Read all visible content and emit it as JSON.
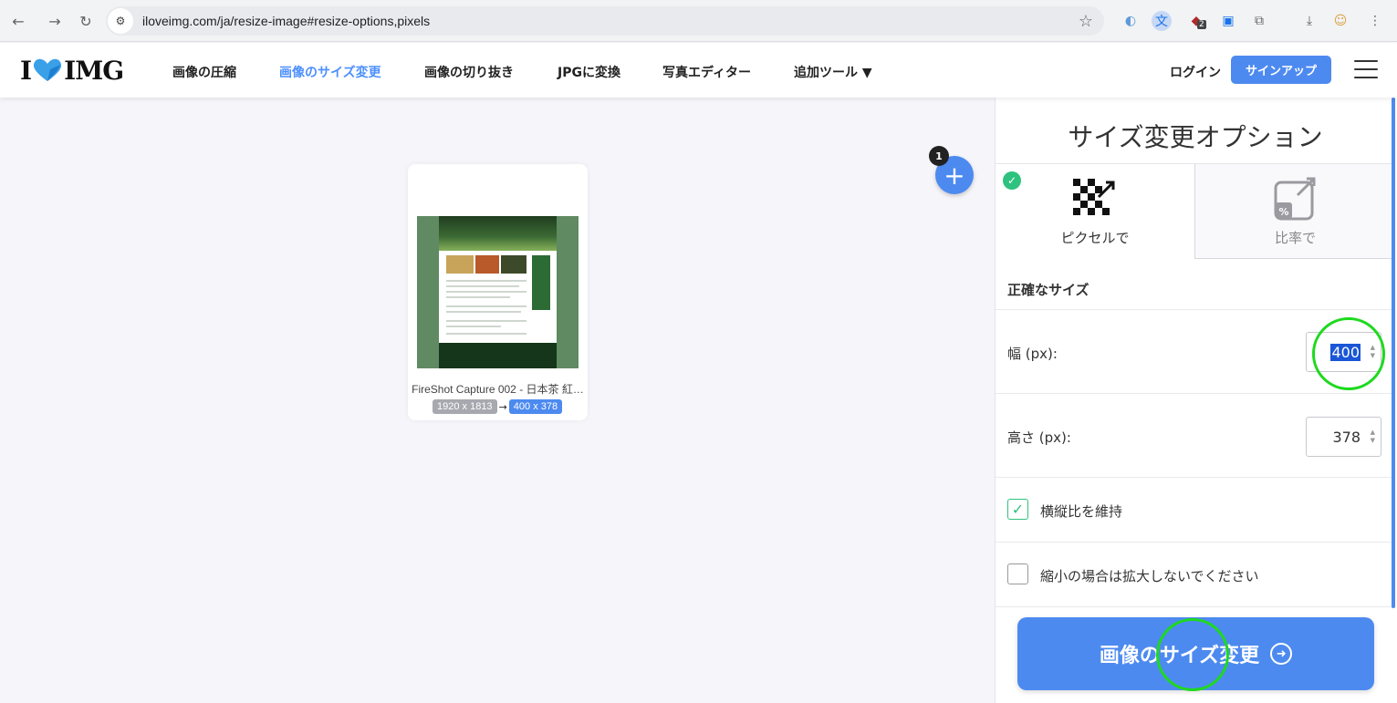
{
  "browser": {
    "url": "iloveimg.com/ja/resize-image#resize-options,pixels",
    "back_icon": "arrow-left",
    "forward_icon": "arrow-right",
    "reload_icon": "reload",
    "ext_badge": "2"
  },
  "header": {
    "logo_left": "I",
    "logo_right": "IMG",
    "nav": [
      "画像の圧縮",
      "画像のサイズ変更",
      "画像の切り抜き",
      "JPGに変換",
      "写真エディター",
      "追加ツール ▼"
    ],
    "active_nav": "画像のサイズ変更",
    "login": "ログイン",
    "signup": "サインアップ"
  },
  "workspace": {
    "file_count": "1",
    "add_button": "+",
    "file": {
      "name": "FireShot Capture 002 - 日本茶 紅…",
      "original_size": "1920 x 1813",
      "arrow": "→",
      "new_size": "400 x 378"
    }
  },
  "panel": {
    "title": "サイズ変更オプション",
    "mode_pixels": "ピクセルで",
    "mode_percent": "比率で",
    "percent_glyph": "%",
    "section": "正確なサイズ",
    "width_label": "幅 (px):",
    "width_value": "400",
    "height_label": "高さ (px):",
    "height_value": "378",
    "keep_ratio": "横縦比を維持",
    "keep_ratio_checked": true,
    "no_enlarge": "縮小の場合は拡大しないでください",
    "no_enlarge_checked": false,
    "submit": "画像のサイズ変更",
    "selected_mode": "pixels"
  },
  "colors": {
    "accent": "#4d8af0",
    "success": "#2ec27e",
    "annotation": "#1ed91e"
  }
}
